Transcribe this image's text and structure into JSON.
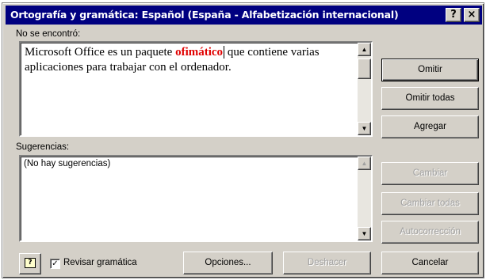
{
  "window": {
    "title": "Ortografía y gramática: Español (España - Alfabetización internacional)",
    "help_button": "?",
    "close_button": "×"
  },
  "not_found": {
    "label": "No se encontró:",
    "text_before": "Microsoft Office es un paquete ",
    "error_word": "ofimático",
    "text_after": " que contiene varias aplicaciones para trabajar con el ordenador."
  },
  "suggestions": {
    "label": "Sugerencias:",
    "items": [
      "(No hay sugerencias)"
    ]
  },
  "buttons": {
    "ignore": "Omitir",
    "ignore_all": "Omitir todas",
    "add": "Agregar",
    "change": "Cambiar",
    "change_all": "Cambiar todas",
    "autocorrect": "Autocorrección",
    "options": "Opciones...",
    "undo": "Deshacer",
    "cancel": "Cancelar"
  },
  "grammar_check": {
    "label": "Revisar gramática",
    "checked": true
  },
  "icons": {
    "scroll_up": "scroll-up-arrow-icon",
    "scroll_down": "scroll-down-arrow-icon",
    "office_assistant": "office-assistant-help-icon"
  }
}
